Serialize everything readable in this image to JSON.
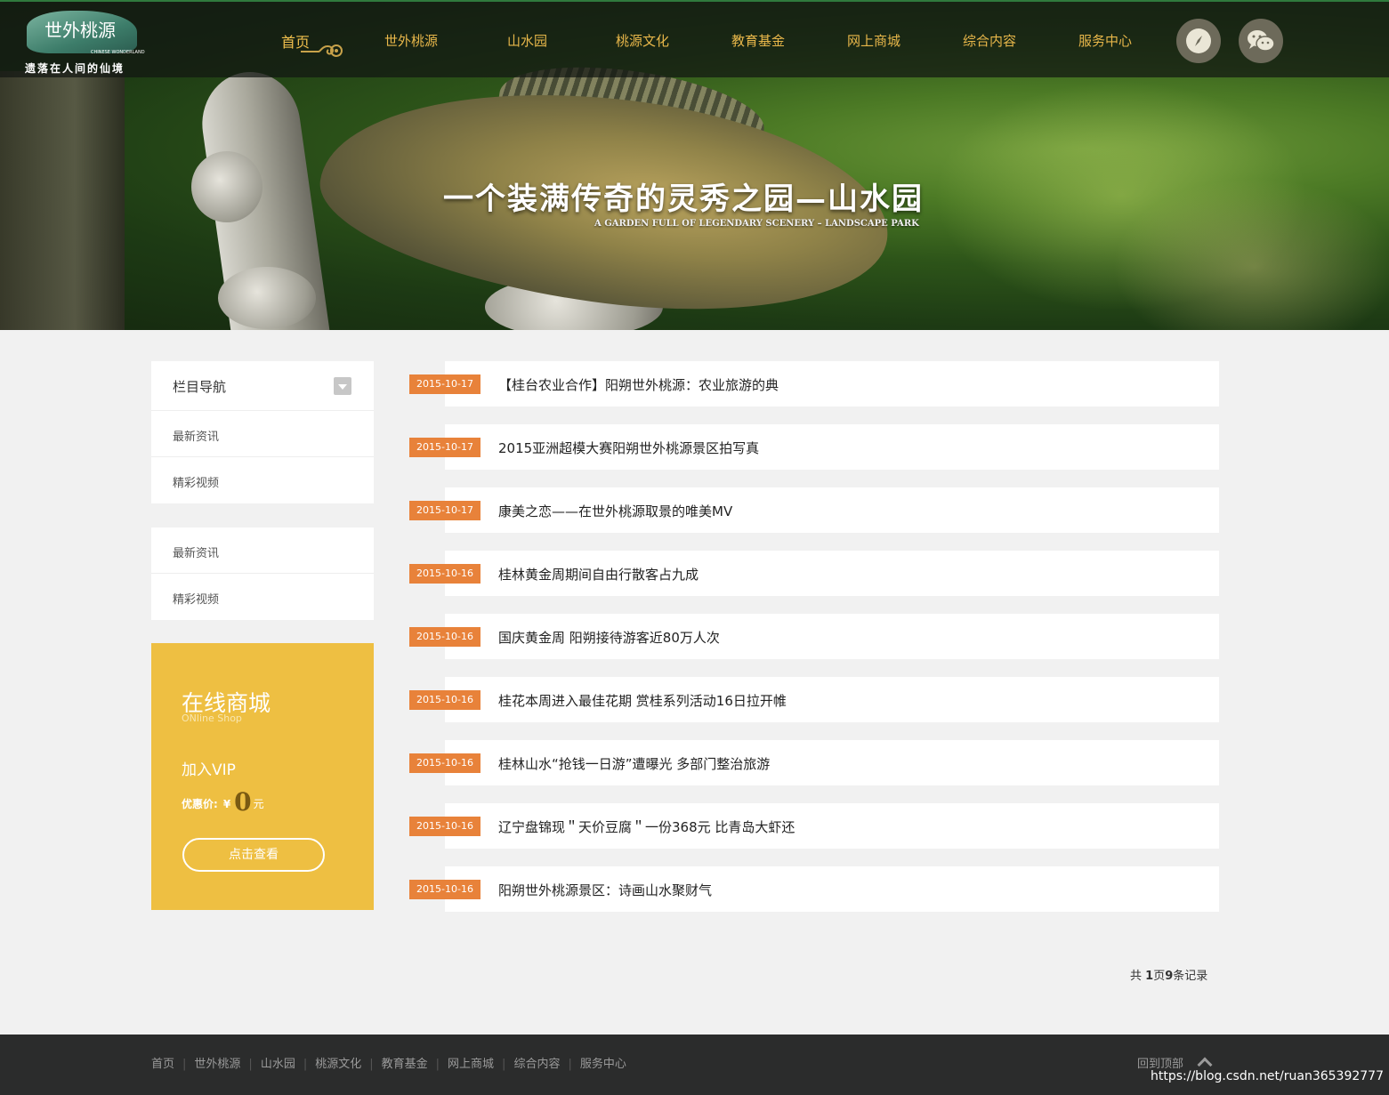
{
  "brand": {
    "name": "世外桃源",
    "name_en": "CHINESE WONDERLAND",
    "slogan": "遗落在人间的仙境"
  },
  "nav": [
    {
      "label": "首页",
      "active": true
    },
    {
      "label": "世外桃源"
    },
    {
      "label": "山水园"
    },
    {
      "label": "桃源文化"
    },
    {
      "label": "教育基金"
    },
    {
      "label": "网上商城"
    },
    {
      "label": "综合内容"
    },
    {
      "label": "服务中心"
    }
  ],
  "nav_icons": [
    "compass-icon",
    "wechat-icon"
  ],
  "banner": {
    "title_cn": "一个装满传奇的灵秀之园—山水园",
    "title_en": "A GARDEN FULL OF LEGENDARY SCENERY – LANDSCAPE PARK"
  },
  "sidebar": {
    "heading": "栏目导航",
    "items": [
      "最新资讯",
      "精彩视频"
    ],
    "items2": [
      "最新资讯",
      "精彩视频"
    ]
  },
  "shop": {
    "title": "在线商城",
    "title_en": "ONline Shop",
    "vip": "加入VIP",
    "price_label": "优惠价:",
    "currency": "¥",
    "price": "0",
    "unit": "元",
    "button": "点击查看"
  },
  "news": [
    {
      "date": "2015-10-17",
      "title": "【桂台农业合作】阳朔世外桃源：农业旅游的典"
    },
    {
      "date": "2015-10-17",
      "title": "2015亚洲超模大赛阳朔世外桃源景区拍写真"
    },
    {
      "date": "2015-10-17",
      "title": "康美之恋——在世外桃源取景的唯美MV"
    },
    {
      "date": "2015-10-16",
      "title": "桂林黄金周期间自由行散客占九成"
    },
    {
      "date": "2015-10-16",
      "title": "国庆黄金周 阳朔接待游客近80万人次"
    },
    {
      "date": "2015-10-16",
      "title": "桂花本周进入最佳花期 赏桂系列活动16日拉开帷"
    },
    {
      "date": "2015-10-16",
      "title": "桂林山水“抢钱一日游”遭曝光 多部门整治旅游"
    },
    {
      "date": "2015-10-16",
      "title": "辽宁盘锦现＂天价豆腐＂一份368元 比青岛大虾还"
    },
    {
      "date": "2015-10-16",
      "title": "阳朔世外桃源景区：诗画山水聚财气"
    }
  ],
  "pager": {
    "prefix": "共 ",
    "pages": "1",
    "mid": "页",
    "records": "9",
    "suffix": "条记录"
  },
  "footer": {
    "links": [
      "首页",
      "世外桃源",
      "山水园",
      "桃源文化",
      "教育基金",
      "网上商城",
      "综合内容",
      "服务中心"
    ],
    "back_top": "回到顶部"
  },
  "watermark": "https://blog.csdn.net/ruan365392777",
  "colors": {
    "accent": "#e8823a",
    "nav_text": "#e8b74a",
    "shop_bg": "#eebf42",
    "footer_bg": "#2b2c2c"
  }
}
